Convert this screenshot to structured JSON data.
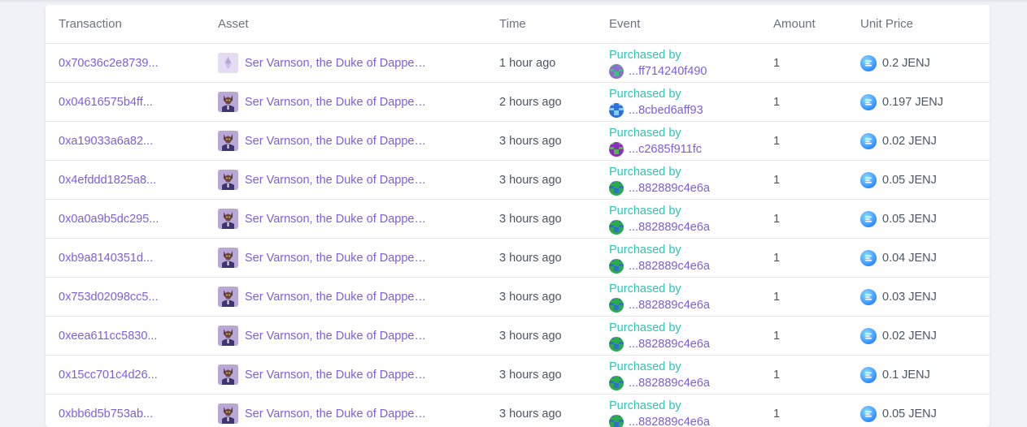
{
  "table": {
    "headers": {
      "transaction": "Transaction",
      "asset": "Asset",
      "time": "Time",
      "event": "Event",
      "amount": "Amount",
      "unit_price": "Unit Price"
    },
    "rows": [
      {
        "transaction": "0x70c36c2e8739...",
        "asset": "Ser Varnson, the Duke of Dapper ...",
        "thumb": "placeholder-eth",
        "time": "1 hour ago",
        "event": "Purchased by",
        "buyer": "...ff714240f490",
        "avatar_colors": [
          "#8a6fc9",
          "#3bbf7a"
        ],
        "amount": "1",
        "price": "0.2 JENJ"
      },
      {
        "transaction": "0x04616575b4ff...",
        "asset": "Ser Varnson, the Duke of Dapper ...",
        "thumb": "duke",
        "time": "2 hours ago",
        "event": "Purchased by",
        "buyer": "...8cbed6aff93",
        "avatar_colors": [
          "#2f6fd6",
          "#7fd0ff"
        ],
        "amount": "1",
        "price": "0.197 JENJ"
      },
      {
        "transaction": "0xa19033a6a82...",
        "asset": "Ser Varnson, the Duke of Dapper ...",
        "thumb": "duke",
        "time": "3 hours ago",
        "event": "Purchased by",
        "buyer": "...c2685f911fc",
        "avatar_colors": [
          "#8a2fb8",
          "#4fb848"
        ],
        "amount": "1",
        "price": "0.02 JENJ"
      },
      {
        "transaction": "0x4efddd1825a8...",
        "asset": "Ser Varnson, the Duke of Dapper ...",
        "thumb": "duke",
        "time": "3 hours ago",
        "event": "Purchased by",
        "buyer": "...882889c4e6a",
        "avatar_colors": [
          "#2fa84f",
          "#2f6fd6"
        ],
        "amount": "1",
        "price": "0.05 JENJ"
      },
      {
        "transaction": "0x0a0a9b5dc295...",
        "asset": "Ser Varnson, the Duke of Dapper ...",
        "thumb": "duke",
        "time": "3 hours ago",
        "event": "Purchased by",
        "buyer": "...882889c4e6a",
        "avatar_colors": [
          "#2fa84f",
          "#2f6fd6"
        ],
        "amount": "1",
        "price": "0.05 JENJ"
      },
      {
        "transaction": "0xb9a8140351d...",
        "asset": "Ser Varnson, the Duke of Dapper ...",
        "thumb": "duke",
        "time": "3 hours ago",
        "event": "Purchased by",
        "buyer": "...882889c4e6a",
        "avatar_colors": [
          "#2fa84f",
          "#2f6fd6"
        ],
        "amount": "1",
        "price": "0.04 JENJ"
      },
      {
        "transaction": "0x753d02098cc5...",
        "asset": "Ser Varnson, the Duke of Dapper ...",
        "thumb": "duke",
        "time": "3 hours ago",
        "event": "Purchased by",
        "buyer": "...882889c4e6a",
        "avatar_colors": [
          "#2fa84f",
          "#2f6fd6"
        ],
        "amount": "1",
        "price": "0.03 JENJ"
      },
      {
        "transaction": "0xeea611cc5830...",
        "asset": "Ser Varnson, the Duke of Dapper ...",
        "thumb": "duke",
        "time": "3 hours ago",
        "event": "Purchased by",
        "buyer": "...882889c4e6a",
        "avatar_colors": [
          "#2fa84f",
          "#2f6fd6"
        ],
        "amount": "1",
        "price": "0.02 JENJ"
      },
      {
        "transaction": "0x15cc701c4d26...",
        "asset": "Ser Varnson, the Duke of Dapper ...",
        "thumb": "duke",
        "time": "3 hours ago",
        "event": "Purchased by",
        "buyer": "...882889c4e6a",
        "avatar_colors": [
          "#2fa84f",
          "#2f6fd6"
        ],
        "amount": "1",
        "price": "0.1 JENJ"
      },
      {
        "transaction": "0xbb6d5b753ab...",
        "asset": "Ser Varnson, the Duke of Dapper ...",
        "thumb": "duke",
        "time": "3 hours ago",
        "event": "Purchased by",
        "buyer": "...882889c4e6a",
        "avatar_colors": [
          "#2fa84f",
          "#2f6fd6"
        ],
        "amount": "1",
        "price": "0.05 JENJ"
      }
    ]
  },
  "colors": {
    "link": "#7b61d6",
    "event": "#2ec4b6",
    "text": "#4b5563",
    "header": "#6b7280"
  },
  "icons": {
    "coin": "enj-coin-icon",
    "thumb": "duke-portrait-icon",
    "placeholder": "ethereum-icon"
  }
}
